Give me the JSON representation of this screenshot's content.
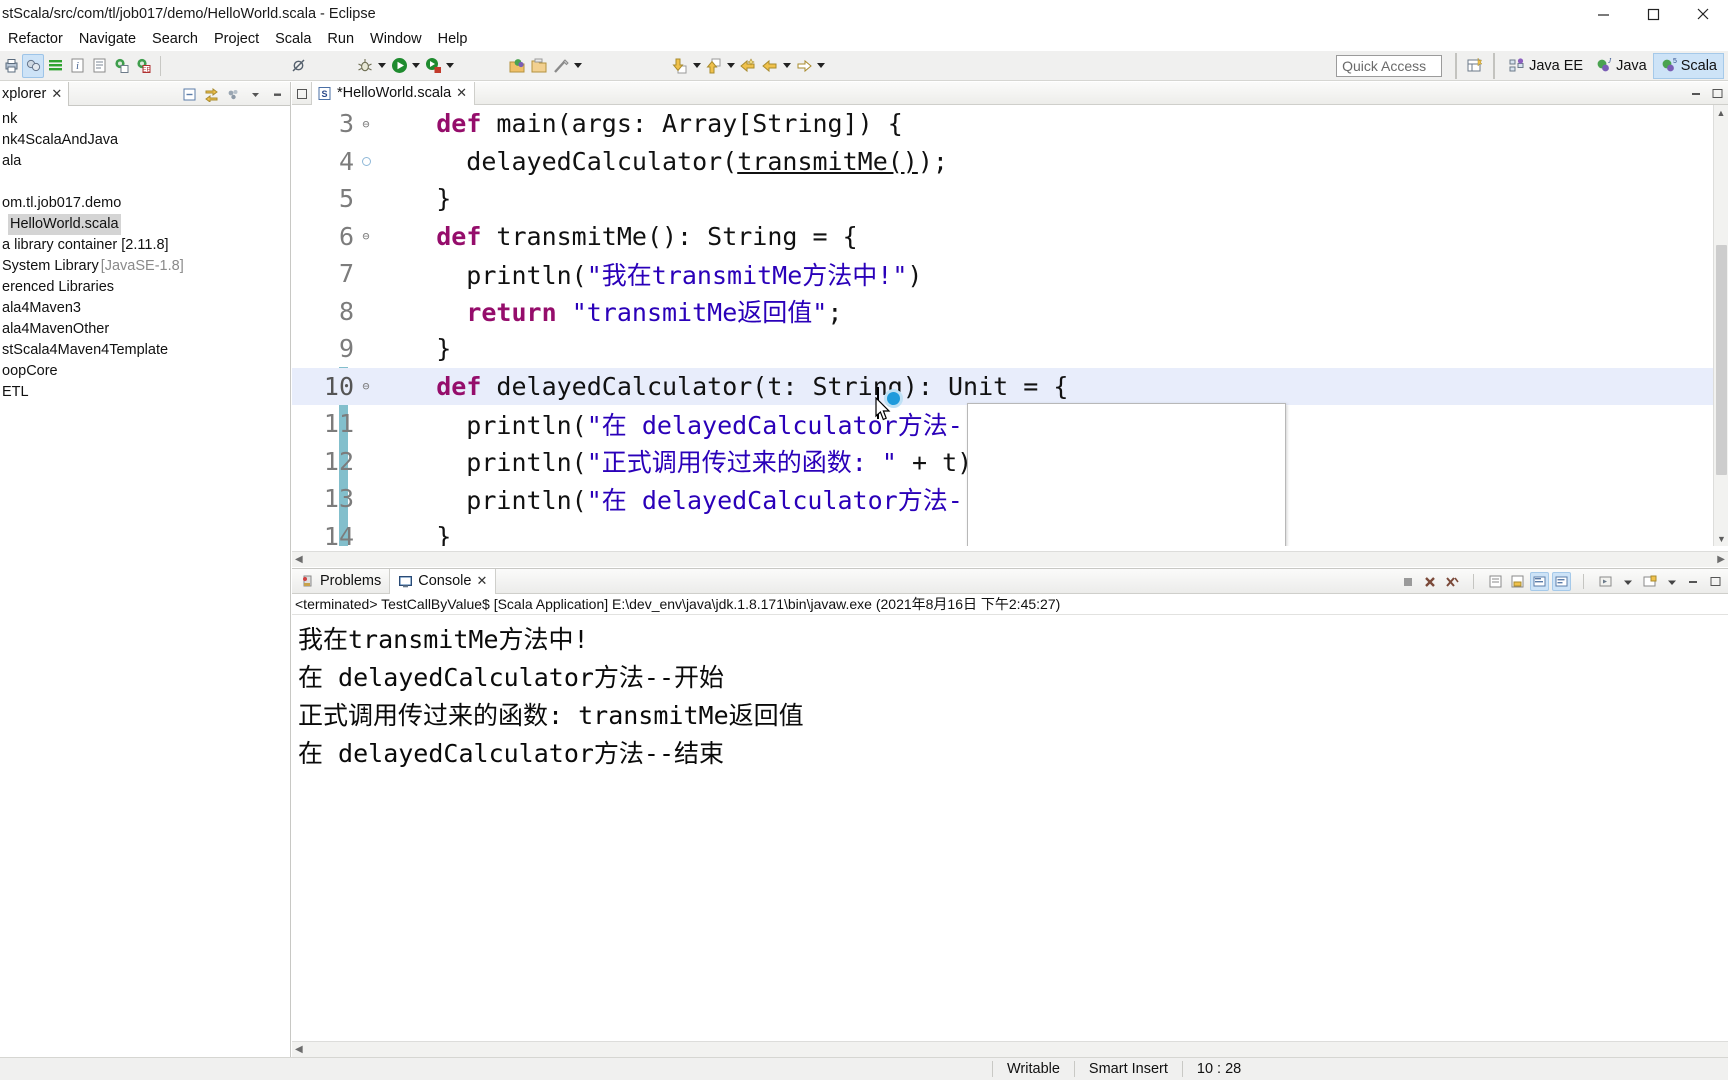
{
  "window": {
    "title": "stScala/src/com/tl/job017/demo/HelloWorld.scala - Eclipse",
    "minimize_label": "minimize-icon",
    "maximize_label": "maximize-icon",
    "close_label": "close-icon"
  },
  "menubar": {
    "items": [
      {
        "label": "Refactor"
      },
      {
        "label": "Navigate"
      },
      {
        "label": "Search"
      },
      {
        "label": "Project"
      },
      {
        "label": "Scala"
      },
      {
        "label": "Run"
      },
      {
        "label": "Window"
      },
      {
        "label": "Help"
      }
    ]
  },
  "toolbar": {
    "quick_access_placeholder": "Quick Access",
    "perspectives": [
      {
        "label": "Java EE",
        "active": false
      },
      {
        "label": "Java",
        "active": false
      },
      {
        "label": "Scala",
        "active": true
      }
    ]
  },
  "explorer": {
    "tab_label": "xplorer",
    "items": [
      {
        "label": "nk",
        "dim": "",
        "selected": false,
        "indent": 0
      },
      {
        "label": "nk4ScalaAndJava",
        "dim": "",
        "selected": false,
        "indent": 0
      },
      {
        "label": "ala",
        "dim": "",
        "selected": false,
        "indent": 0
      },
      {
        "label": "",
        "dim": "",
        "selected": false,
        "indent": 0
      },
      {
        "label": "om.tl.job017.demo",
        "dim": "",
        "selected": false,
        "indent": 0
      },
      {
        "label": "HelloWorld.scala",
        "dim": "",
        "selected": true,
        "indent": 8
      },
      {
        "label": "a library container [2.11.8]",
        "dim": "",
        "selected": false,
        "indent": 0
      },
      {
        "label": "System Library ",
        "dim": "[JavaSE-1.8]",
        "selected": false,
        "indent": 0
      },
      {
        "label": "erenced Libraries",
        "dim": "",
        "selected": false,
        "indent": 0
      },
      {
        "label": "ala4Maven3",
        "dim": "",
        "selected": false,
        "indent": 0
      },
      {
        "label": "ala4MavenOther",
        "dim": "",
        "selected": false,
        "indent": 0
      },
      {
        "label": "stScala4Maven4Template",
        "dim": "",
        "selected": false,
        "indent": 0
      },
      {
        "label": "oopCore",
        "dim": "",
        "selected": false,
        "indent": 0
      },
      {
        "label": "ETL",
        "dim": "",
        "selected": false,
        "indent": 0
      }
    ]
  },
  "editor": {
    "tab_label": "*HelloWorld.scala",
    "tab_close": "✕",
    "lines": [
      {
        "number": "3",
        "fold": "⊖",
        "current": false,
        "tokens": [
          {
            "t": "    ",
            "c": "plain"
          },
          {
            "t": "def",
            "c": "kw"
          },
          {
            "t": " main(args: Array[String]) {",
            "c": "plain"
          }
        ]
      },
      {
        "number": "4",
        "fold": "",
        "current": false,
        "tokens": [
          {
            "t": "      delayedCalculator(",
            "c": "plain"
          },
          {
            "t": "transmitMe()",
            "c": "undl"
          },
          {
            "t": ");",
            "c": "plain"
          }
        ]
      },
      {
        "number": "5",
        "fold": "",
        "current": false,
        "tokens": [
          {
            "t": "    }",
            "c": "plain"
          }
        ]
      },
      {
        "number": "6",
        "fold": "⊖",
        "current": false,
        "tokens": [
          {
            "t": "    ",
            "c": "plain"
          },
          {
            "t": "def",
            "c": "kw"
          },
          {
            "t": " transmitMe(): String = {",
            "c": "plain"
          }
        ]
      },
      {
        "number": "7",
        "fold": "",
        "current": false,
        "tokens": [
          {
            "t": "      println(",
            "c": "plain"
          },
          {
            "t": "\"我在transmitMe方法中!\"",
            "c": "str"
          },
          {
            "t": ")",
            "c": "plain"
          }
        ]
      },
      {
        "number": "8",
        "fold": "",
        "current": false,
        "tokens": [
          {
            "t": "      ",
            "c": "plain"
          },
          {
            "t": "return",
            "c": "kw"
          },
          {
            "t": " ",
            "c": "plain"
          },
          {
            "t": "\"transmitMe返回值\"",
            "c": "str"
          },
          {
            "t": ";",
            "c": "plain"
          }
        ]
      },
      {
        "number": "9",
        "fold": "",
        "current": false,
        "tokens": [
          {
            "t": "    }",
            "c": "plain"
          }
        ]
      },
      {
        "number": "10",
        "fold": "⊖",
        "current": true,
        "tokens": [
          {
            "t": "    ",
            "c": "plain"
          },
          {
            "t": "def",
            "c": "kw"
          },
          {
            "t": " delayedCalculator(t: String): Unit = {",
            "c": "plain"
          }
        ]
      },
      {
        "number": "11",
        "fold": "",
        "current": false,
        "tokens": [
          {
            "t": "      println(",
            "c": "plain"
          },
          {
            "t": "\"在 delayedCalculator方法--开始\"",
            "c": "str"
          },
          {
            "t": ")",
            "c": "plain"
          }
        ]
      },
      {
        "number": "12",
        "fold": "",
        "current": false,
        "tokens": [
          {
            "t": "      println(",
            "c": "plain"
          },
          {
            "t": "\"正式调用传过来的函数: \"",
            "c": "str"
          },
          {
            "t": " + t)",
            "c": "plain"
          }
        ]
      },
      {
        "number": "13",
        "fold": "",
        "current": false,
        "tokens": [
          {
            "t": "      println(",
            "c": "plain"
          },
          {
            "t": "\"在 delayedCalculator方法--结束\"",
            "c": "str"
          },
          {
            "t": ")",
            "c": "plain"
          }
        ]
      },
      {
        "number": "14",
        "fold": "",
        "current": false,
        "tokens": [
          {
            "t": "    }",
            "c": "plain"
          }
        ]
      }
    ]
  },
  "console": {
    "tabs": [
      {
        "label": "Problems",
        "active": false
      },
      {
        "label": "Console",
        "active": true
      }
    ],
    "tab_close": "✕",
    "header": "<terminated> TestCallByValue$ [Scala Application] E:\\dev_env\\java\\jdk.1.8.171\\bin\\javaw.exe (2021年8月16日 下午2:45:27)",
    "output": [
      "我在transmitMe方法中!",
      "在 delayedCalculator方法--开始",
      "正式调用传过来的函数: transmitMe返回值",
      "在 delayedCalculator方法--结束"
    ]
  },
  "statusbar": {
    "writable": "Writable",
    "insert_mode": "Smart Insert",
    "position": "10 : 28"
  }
}
